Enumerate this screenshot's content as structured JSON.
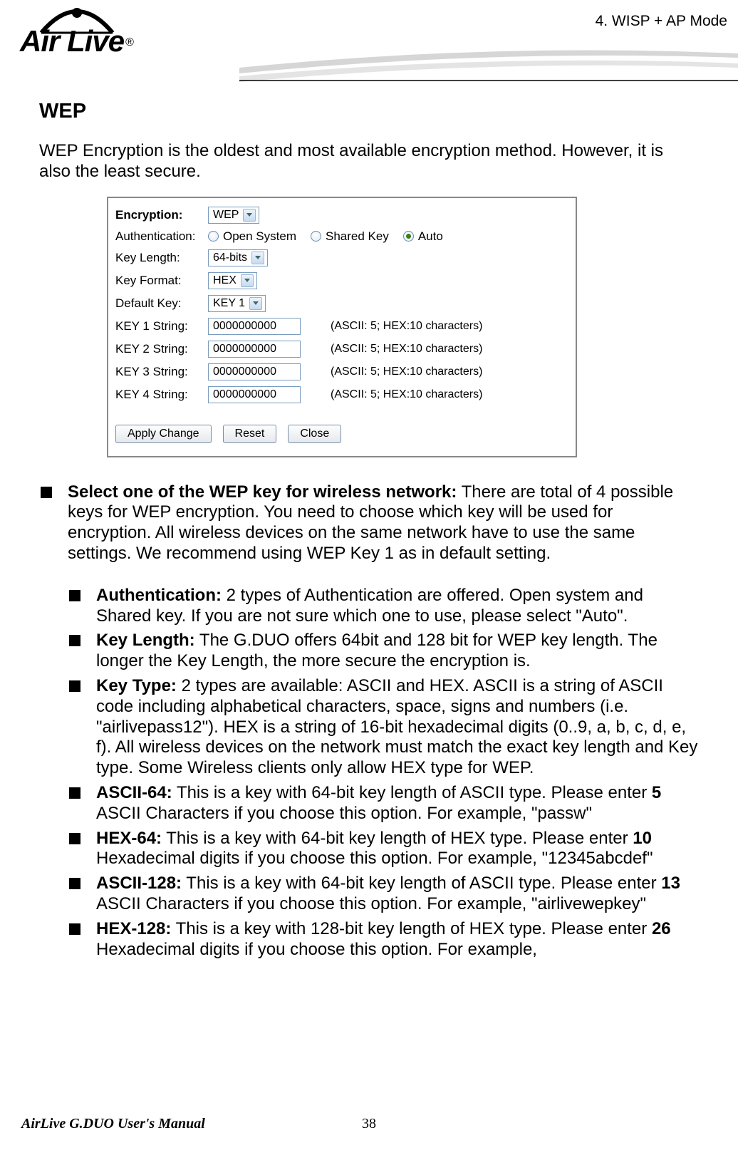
{
  "header": {
    "brand_prefix": "Air",
    "brand_suffix": "Live",
    "breadcrumb": "4. WISP + AP Mode"
  },
  "section": {
    "title": "WEP",
    "intro": "WEP Encryption is the oldest and most available encryption method.    However, it is also the least secure."
  },
  "config": {
    "encryption_label": "Encryption:",
    "encryption_value": "WEP",
    "auth_label": "Authentication:",
    "auth_open": "Open System",
    "auth_shared": "Shared Key",
    "auth_auto": "Auto",
    "keylen_label": "Key Length:",
    "keylen_value": "64-bits",
    "keyfmt_label": "Key Format:",
    "keyfmt_value": "HEX",
    "defkey_label": "Default Key:",
    "defkey_value": "KEY 1",
    "keys": [
      {
        "label": "KEY 1 String:",
        "value": "0000000000",
        "hint": "(ASCII: 5; HEX:10 characters)"
      },
      {
        "label": "KEY 2 String:",
        "value": "0000000000",
        "hint": "(ASCII: 5; HEX:10 characters)"
      },
      {
        "label": "KEY 3 String:",
        "value": "0000000000",
        "hint": "(ASCII: 5; HEX:10 characters)"
      },
      {
        "label": "KEY 4 String:",
        "value": "0000000000",
        "hint": "(ASCII: 5; HEX:10 characters)"
      }
    ],
    "apply_label": "Apply Change",
    "reset_label": "Reset",
    "close_label": "Close"
  },
  "bullets": {
    "main": {
      "label": "Select one of the WEP key for wireless network:",
      "text": "   There are total of 4 possible keys for WEP encryption.    You need to choose which key will be used for encryption.    All wireless devices on the same network have to use the same settings.    We recommend using WEP Key 1 as in default setting."
    },
    "sub": [
      {
        "label": "Authentication:",
        "text": "   2 types of Authentication are offered.    Open system and Shared key.    If you are not sure which one to use, please select \"Auto\"."
      },
      {
        "label": "Key Length:",
        "text": "   The G.DUO offers 64bit and 128 bit for WEP key length.    The longer the Key Length, the more secure the encryption is."
      },
      {
        "label": "Key Type:",
        "text": "   2 types are available: ASCII and HEX.    ASCII is a string of ASCII code including alphabetical characters, space, signs and numbers (i.e. \"airlivepass12\").    HEX is a string of 16-bit hexadecimal digits (0..9, a, b, c, d, e, f). All wireless devices on the network must match the exact key length and Key type. Some Wireless clients only allow HEX type for WEP."
      },
      {
        "label": "ASCII-64:",
        "text": " This is a key with 64-bit key length of ASCII type.    Please enter ",
        "bold_num": "5",
        "text2": " ASCII Characters if you choose this option. For example, \"passw\""
      },
      {
        "label": "HEX-64:",
        "text": " This is a key with 64-bit key length of HEX type.    Please enter ",
        "bold_num": "10",
        "text2": " Hexadecimal digits if you choose this option. For example, \"12345abcdef\""
      },
      {
        "label": "ASCII-128:",
        "text": " This is a key with 64-bit key length of ASCII type.    Please enter ",
        "bold_num": "13",
        "text2": " ASCII Characters if you choose this option. For example, \"airlivewepkey\""
      },
      {
        "label": "HEX-128:",
        "text": " This is a key with 128-bit key length of HEX type.    Please enter ",
        "bold_num": "26",
        "text2": " Hexadecimal digits if you choose this option. For example,"
      }
    ]
  },
  "footer": {
    "manual": "AirLive G.DUO User's Manual",
    "page": "38"
  }
}
